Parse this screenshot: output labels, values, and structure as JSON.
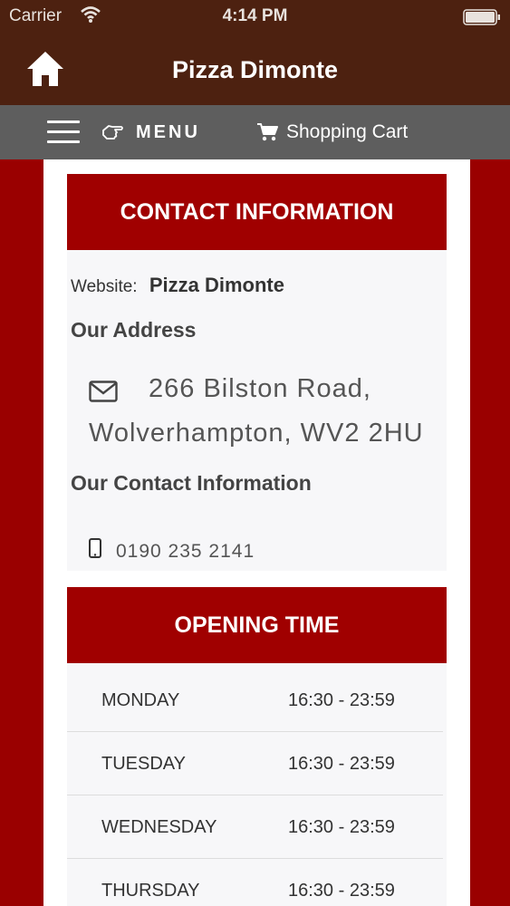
{
  "status": {
    "carrier": "Carrier",
    "time": "4:14 PM"
  },
  "header": {
    "title": "Pizza Dimonte"
  },
  "menubar": {
    "menu_label": "MENU",
    "cart_label": "Shopping Cart"
  },
  "contact": {
    "header": "CONTACT INFORMATION",
    "website_label": "Website:",
    "website_value": "Pizza Dimonte",
    "address_title": "Our Address",
    "address_line1": "266 Bilston Road,",
    "address_line2": "Wolverhampton, WV2 2HU",
    "contact_title": "Our Contact Information",
    "phone": "0190 235 2141"
  },
  "opening": {
    "header": "OPENING TIME",
    "rows": [
      {
        "day": "MONDAY",
        "time": "16:30 - 23:59"
      },
      {
        "day": "TUESDAY",
        "time": "16:30 - 23:59"
      },
      {
        "day": "WEDNESDAY",
        "time": "16:30 - 23:59"
      },
      {
        "day": "THURSDAY",
        "time": "16:30 - 23:59"
      }
    ]
  },
  "colors": {
    "header_bg": "#4d2110",
    "accent": "#a00000",
    "menu_bg": "#5e5e5e",
    "page_bg": "#9a0000"
  }
}
